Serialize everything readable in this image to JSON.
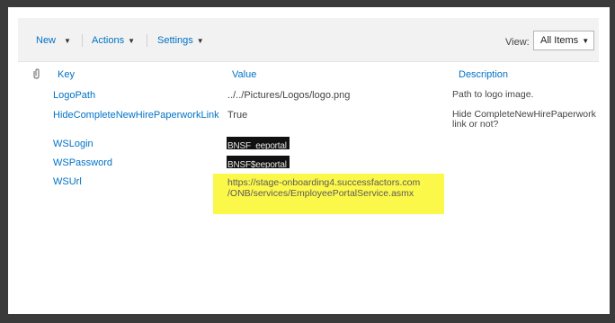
{
  "toolbar": {
    "new_label": "New",
    "actions_label": "Actions",
    "settings_label": "Settings",
    "view_label": "View:",
    "view_value": "All Items"
  },
  "icons": {
    "dropdown": "caret-down-icon",
    "attachment": "paperclip-icon"
  },
  "columns": {
    "key": "Key",
    "value": "Value",
    "description": "Description"
  },
  "rows": [
    {
      "key": "LogoPath",
      "value": "../../Pictures/Logos/logo.png",
      "description": "Path to logo image."
    },
    {
      "key": "HideCompleteNewHirePaperworkLink",
      "value": "True",
      "description_line1": "Hide CompleteNewHirePaperwork",
      "description_line2": "link or not?"
    },
    {
      "key": "WSLogin",
      "value": "BNSF_eeportal"
    },
    {
      "key": "WSPassword",
      "value": "BNSF$eeportal"
    },
    {
      "key": "WSUrl",
      "value_line1": "https://stage-onboarding4.successfactors.com",
      "value_line2": "/ONB/services/EmployeePortalService.asmx"
    }
  ],
  "colors": {
    "link": "#0072c6",
    "highlight": "#fcf84a",
    "redaction": "#111111"
  }
}
